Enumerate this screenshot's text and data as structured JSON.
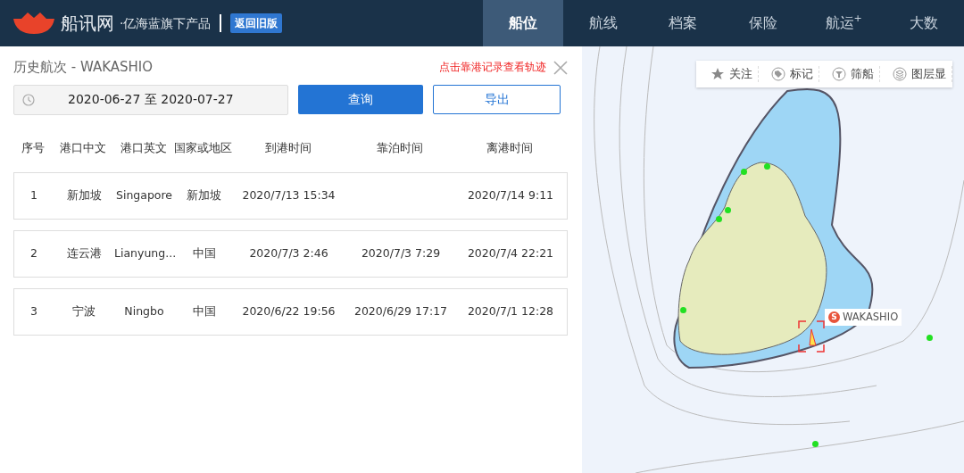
{
  "header": {
    "logo": "船讯网",
    "tagline": "·亿海蓝旗下产品",
    "old_version_button": "返回旧版",
    "tabs": [
      {
        "label": "船位",
        "selected": true
      },
      {
        "label": "航线",
        "selected": false
      },
      {
        "label": "档案",
        "selected": false
      },
      {
        "label": "保险",
        "selected": false
      },
      {
        "label": "航运$^{+}$",
        "selected": false
      },
      {
        "label": "大数",
        "selected": false
      }
    ]
  },
  "panel": {
    "title": "历史航次 - WAKASHIO",
    "hint": "点击靠港记录查看轨迹",
    "date_range": "2020-06-27 至 2020-07-27",
    "query_button": "查询",
    "export_button": "导出",
    "table": {
      "columns": [
        "序号",
        "港口中文",
        "港口英文",
        "国家或地区",
        "到港时间",
        "靠泊时间",
        "离港时间"
      ],
      "rows": [
        [
          "1",
          "新加坡",
          "Singapore",
          "新加坡",
          "2020/7/13 15:34",
          "",
          "2020/7/14 9:11"
        ],
        [
          "2",
          "连云港",
          "Lianyung...",
          "中国",
          "2020/7/3 2:46",
          "2020/7/3 7:29",
          "2020/7/4 22:21"
        ],
        [
          "3",
          "宁波",
          "Ningbo",
          "中国",
          "2020/6/22 19:56",
          "2020/6/29 17:17",
          "2020/7/1 12:28"
        ]
      ]
    }
  },
  "map": {
    "toolbar": [
      {
        "kind": "star",
        "label": "关注"
      },
      {
        "kind": "tag",
        "label": "标记"
      },
      {
        "kind": "filter",
        "label": "筛船"
      },
      {
        "kind": "layers",
        "label": "图层显"
      }
    ],
    "vessel": {
      "badge": "S",
      "name": "WAKASHIO"
    }
  }
}
